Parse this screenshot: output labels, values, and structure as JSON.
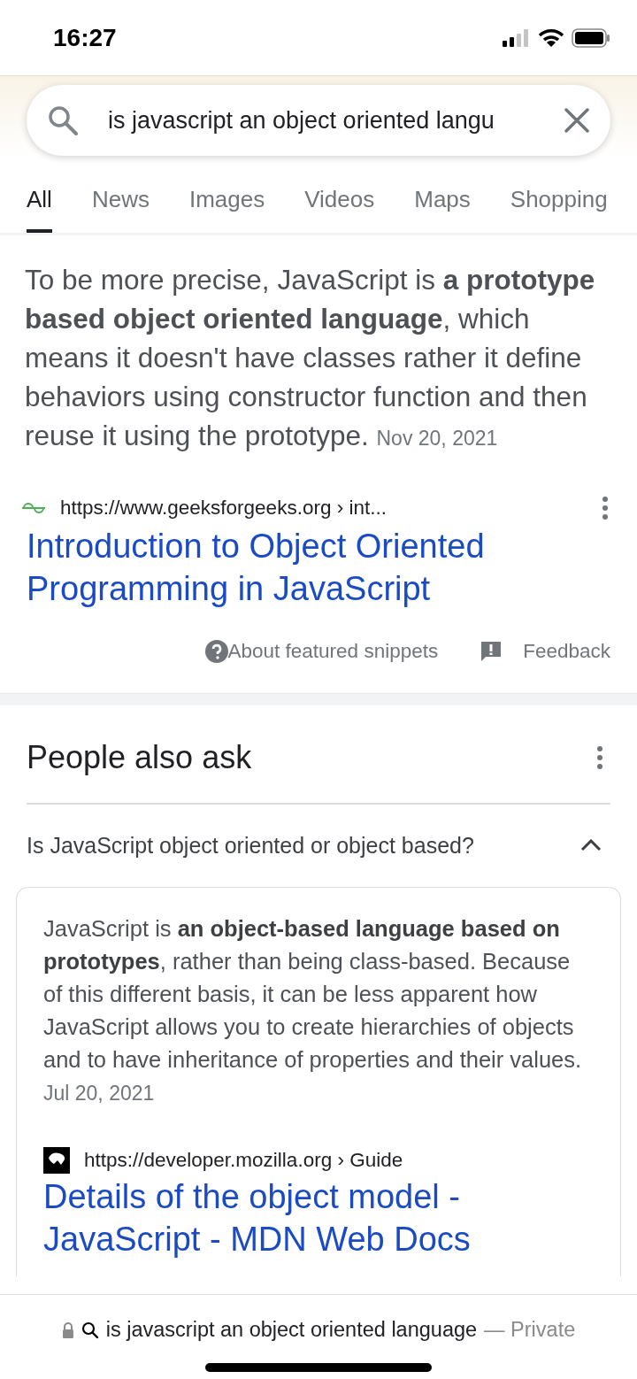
{
  "status_bar": {
    "time": "16:27"
  },
  "search": {
    "value": "is javascript an object oriented langu"
  },
  "tabs": [
    {
      "label": "All",
      "selected": true
    },
    {
      "label": "News",
      "selected": false
    },
    {
      "label": "Images",
      "selected": false
    },
    {
      "label": "Videos",
      "selected": false
    },
    {
      "label": "Maps",
      "selected": false
    },
    {
      "label": "Shopping",
      "selected": false
    }
  ],
  "featured_snippet": {
    "text": "To be more precise, JavaScript is **a prototype based object oriented language**, which means it doesn't have classes rather it define behaviors using constructor function and then reuse it using the prototype.",
    "date": "Nov 20, 2021",
    "source_url": "https://www.geeksforgeeks.org › int...",
    "title": "Introduction to Object Oriented Programming in JavaScript",
    "about_link": "About featured snippets",
    "feedback_link": "Feedback"
  },
  "people_also_ask": {
    "title": "People also ask",
    "questions": [
      {
        "question": "Is JavaScript object oriented or object based?",
        "expanded": true,
        "answer": "JavaScript is **an object-based language based on prototypes**, rather than being class-based. Because of this different basis, it can be less apparent how JavaScript allows you to create hierarchies of objects and to have inheritance of properties and their values.",
        "date": "Jul 20, 2021",
        "source_url": "https://developer.mozilla.org › Guide",
        "title": "Details of the object model - JavaScript - MDN Web Docs"
      }
    ]
  },
  "address_bar": {
    "query": "is javascript an object oriented language",
    "mode": "— Private"
  }
}
